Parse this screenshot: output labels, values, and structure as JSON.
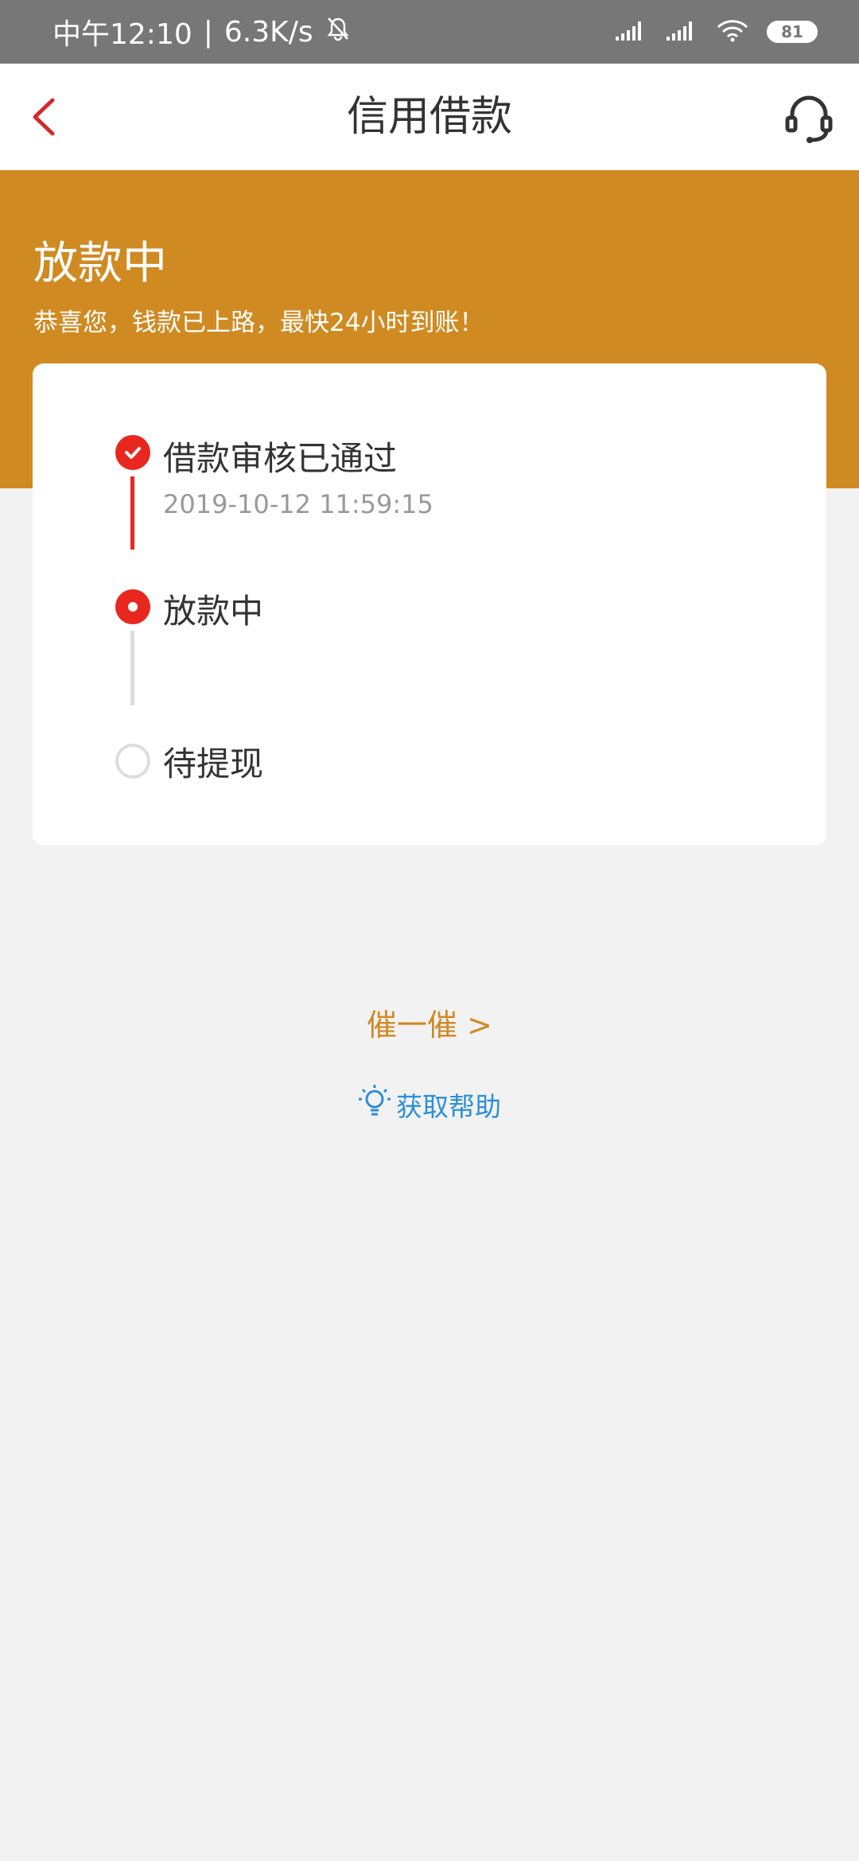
{
  "status_bar": {
    "time": "中午12:10",
    "separator": "|",
    "speed": "6.3K/s",
    "battery": "81"
  },
  "header": {
    "title": "信用借款"
  },
  "banner": {
    "title": "放款中",
    "subtitle": "恭喜您，钱款已上路，最快24小时到账！"
  },
  "progress": {
    "steps": [
      {
        "label": "借款审核已通过",
        "time": "2019-10-12 11:59:15",
        "state": "done"
      },
      {
        "label": "放款中",
        "state": "active"
      },
      {
        "label": "待提现",
        "state": "pending"
      }
    ]
  },
  "actions": {
    "urge_label": "催一催 >",
    "help_label": "获取帮助"
  },
  "colors": {
    "accent": "#d08a22",
    "step_active": "#e8281e",
    "help_link": "#2b8fd6"
  }
}
